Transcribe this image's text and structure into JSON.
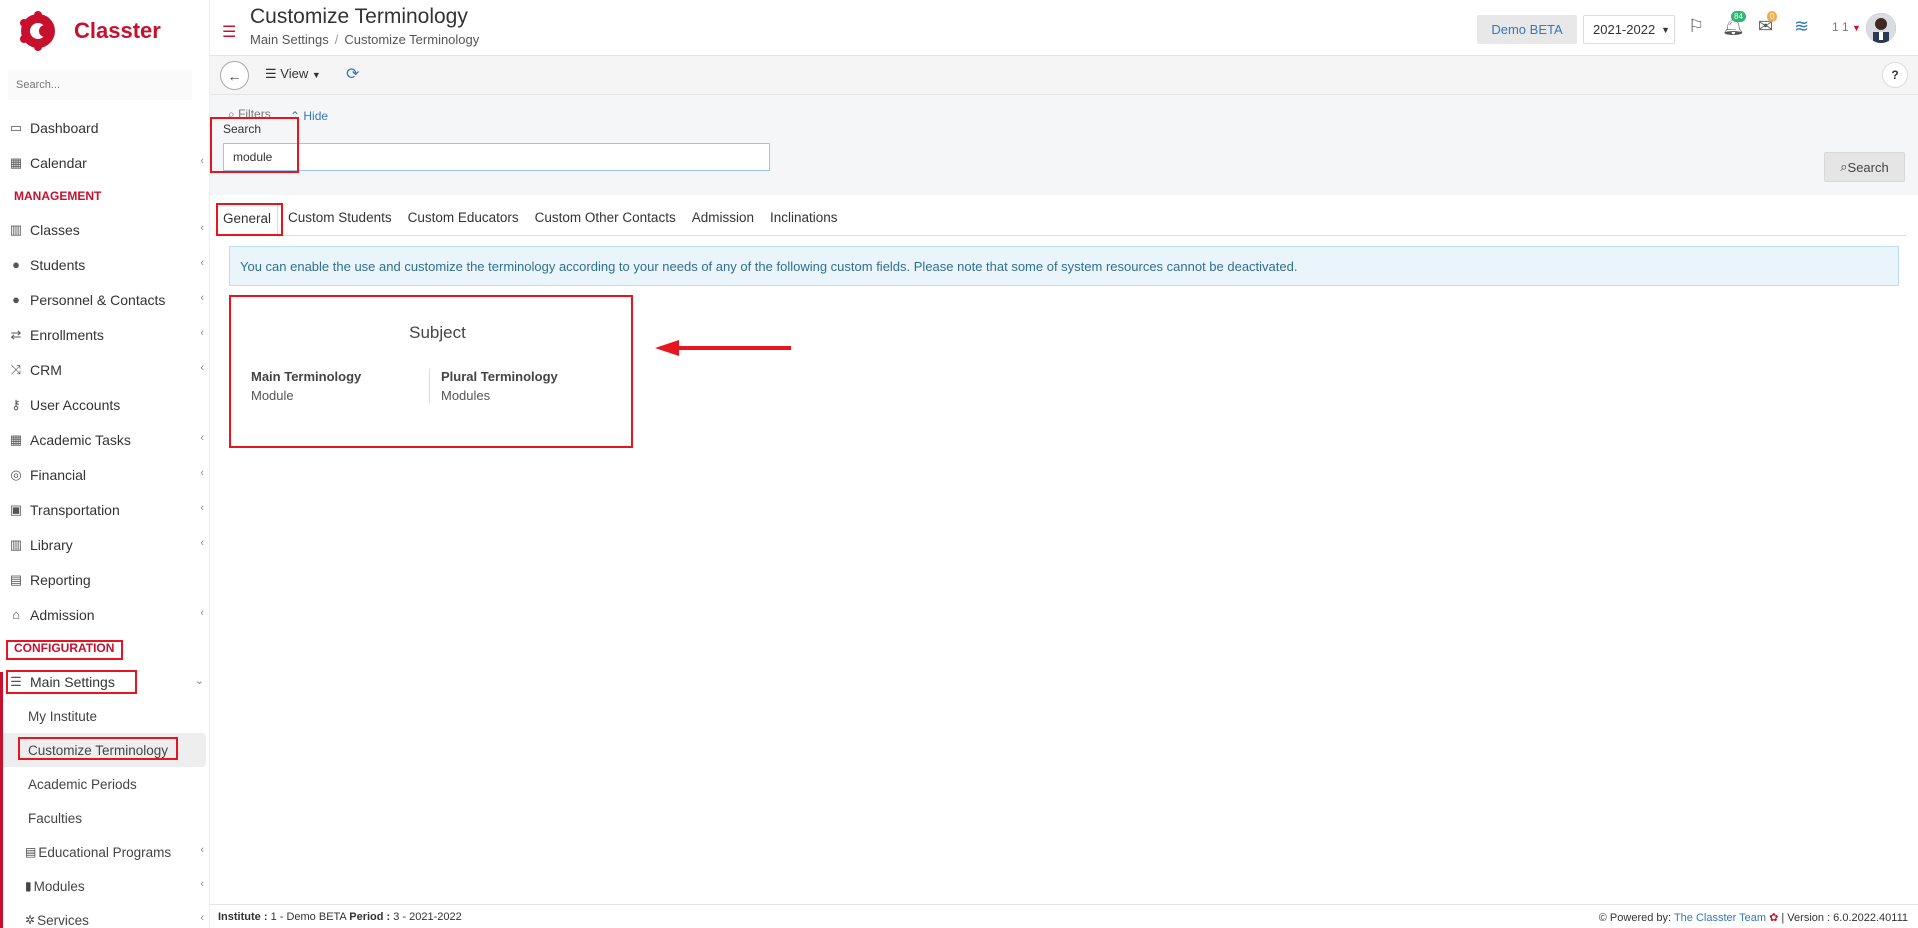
{
  "app": {
    "name": "Classter"
  },
  "sidebar": {
    "search_placeholder": "Search...",
    "top_items": [
      {
        "label": "Dashboard",
        "icon": "laptop-icon",
        "chevron": false
      },
      {
        "label": "Calendar",
        "icon": "calendar-icon",
        "chevron": true
      }
    ],
    "management_label": "MANAGEMENT",
    "management_items": [
      {
        "label": "Classes",
        "icon": "classes-icon",
        "chevron": true
      },
      {
        "label": "Students",
        "icon": "students-icon",
        "chevron": true
      },
      {
        "label": "Personnel & Contacts",
        "icon": "personnel-icon",
        "chevron": true
      },
      {
        "label": "Enrollments",
        "icon": "exchange-icon",
        "chevron": true
      },
      {
        "label": "CRM",
        "icon": "shuffle-icon",
        "chevron": true
      },
      {
        "label": "User Accounts",
        "icon": "key-icon",
        "chevron": false
      },
      {
        "label": "Academic Tasks",
        "icon": "grid-icon",
        "chevron": true
      },
      {
        "label": "Financial",
        "icon": "coins-icon",
        "chevron": true
      },
      {
        "label": "Transportation",
        "icon": "bus-icon",
        "chevron": true
      },
      {
        "label": "Library",
        "icon": "books-icon",
        "chevron": true
      },
      {
        "label": "Reporting",
        "icon": "printer-icon",
        "chevron": false
      },
      {
        "label": "Admission",
        "icon": "bank-icon",
        "chevron": true
      }
    ],
    "configuration_label": "CONFIGURATION",
    "main_settings_label": "Main Settings",
    "main_settings_sub": [
      {
        "label": "My Institute",
        "active": false
      },
      {
        "label": "Customize Terminology",
        "active": true
      },
      {
        "label": "Academic Periods",
        "active": false
      },
      {
        "label": "Faculties",
        "active": false
      },
      {
        "label": "Educational Programs",
        "active": false
      },
      {
        "label": "Modules",
        "active": false
      },
      {
        "label": "Services",
        "active": false
      }
    ]
  },
  "header": {
    "title": "Customize Terminology",
    "breadcrumb": [
      "Main Settings",
      "Customize Terminology"
    ],
    "demo_label": "Demo BETA",
    "year": "2021-2022",
    "notifications_count": "84",
    "messages_count": "0",
    "user_label": "1 1"
  },
  "toolbar": {
    "view_label": "View",
    "help_label": "?"
  },
  "filters": {
    "filters_label": "Filters",
    "hide_label": "Hide",
    "search_label": "Search",
    "search_value": "module",
    "search_button": "Search"
  },
  "tabs": [
    {
      "label": "General",
      "active": true
    },
    {
      "label": "Custom Students",
      "active": false
    },
    {
      "label": "Custom Educators",
      "active": false
    },
    {
      "label": "Custom Other Contacts",
      "active": false
    },
    {
      "label": "Admission",
      "active": false
    },
    {
      "label": "Inclinations",
      "active": false
    }
  ],
  "info_message": "You can enable the use and customize the terminology according to your needs of any of the following custom fields. Please note that some of system resources cannot be deactivated.",
  "card": {
    "title": "Subject",
    "main_label": "Main Terminology",
    "main_value": "Module",
    "plural_label": "Plural Terminology",
    "plural_value": "Modules"
  },
  "footer": {
    "institute_label": "Institute :",
    "institute_value": "1 - Demo BETA",
    "period_label": "Period :",
    "period_value": "3 - 2021-2022",
    "powered_by": "Powered by:",
    "team": "The Classter Team",
    "version": "| Version : 6.0.2022.40111"
  },
  "colors": {
    "brand": "#c8102e",
    "link": "#337ab7",
    "annotation": "#e8141e"
  }
}
